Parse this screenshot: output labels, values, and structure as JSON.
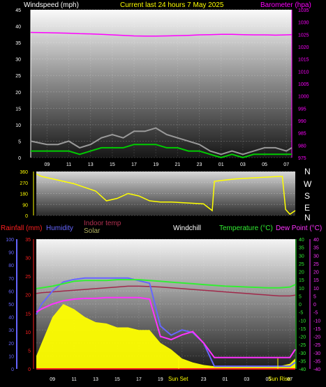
{
  "header": {
    "left_title": "Windspeed (mph)",
    "center_title": "Current last 24 hours 7 May 2025",
    "right_title": "Barometer (hpa)"
  },
  "direction_letters": [
    "N",
    "W",
    "S",
    "E",
    "N"
  ],
  "temp_legend": {
    "rainfall": "Rainfall (mm)",
    "humidity": "Humidity",
    "indoor": "Indoor temp",
    "solar": "Solar",
    "windchill": "Windchill",
    "temperature": "Temperature (°C)",
    "dewpoint": "Dew Point (°C)"
  },
  "sun_labels": {
    "sunset": "Sun Set",
    "sunrise": "Sun Rise"
  },
  "colors": {
    "windspeed": "#ffffff",
    "gust": "#9a9a9a",
    "wind_avg": "#00cc00",
    "barometer": "#ff00ff",
    "direction": "#ffff00",
    "temperature": "#33ee33",
    "dewpoint": "#ff33ff",
    "humidity": "#6666ff",
    "indoor": "#a0284a",
    "solar_fill": "#ffff00",
    "solar_line": "#a0a040",
    "rainfall": "#ff2020",
    "windchill": "#ffffff"
  },
  "chart_data": [
    {
      "type": "line",
      "name": "wind-barometer",
      "x_ticks": [
        "09",
        "11",
        "13",
        "15",
        "17",
        "19",
        "21",
        "23",
        "01",
        "03",
        "05",
        "07"
      ],
      "left_axis": {
        "label": "Windspeed (mph)",
        "range": [
          0,
          45
        ],
        "ticks": [
          0,
          5,
          10,
          15,
          20,
          25,
          30,
          35,
          40,
          45
        ]
      },
      "right_axis": {
        "label": "Barometer (hpa)",
        "range": [
          975,
          1035
        ],
        "ticks": [
          975,
          980,
          985,
          990,
          995,
          1000,
          1005,
          1010,
          1015,
          1020,
          1025,
          1030,
          1035
        ]
      },
      "x_hours": [
        7.5,
        9,
        10,
        11,
        12,
        13,
        14,
        15,
        16,
        17,
        18,
        19,
        20,
        21,
        22,
        23,
        24,
        25,
        26,
        27,
        28,
        29,
        30,
        31,
        31.5
      ],
      "series": [
        {
          "name": "Barometer",
          "axis": "right",
          "values": [
            1025.8,
            1025.7,
            1025.6,
            1025.5,
            1025.3,
            1025.2,
            1025.0,
            1024.8,
            1024.6,
            1024.4,
            1024.3,
            1024.3,
            1024.4,
            1024.5,
            1024.6,
            1024.8,
            1024.9,
            1025.0,
            1025.0,
            1024.9,
            1024.8,
            1024.8,
            1024.7,
            1024.8,
            1024.9
          ]
        },
        {
          "name": "Wind gust",
          "axis": "left",
          "values": [
            5,
            4,
            4,
            5,
            3,
            4,
            6,
            7,
            6,
            8,
            8,
            9,
            7,
            6,
            5,
            4,
            2,
            1,
            2,
            1,
            2,
            3,
            3,
            2,
            3
          ]
        },
        {
          "name": "Wind speed",
          "axis": "left",
          "values": [
            2,
            2,
            2,
            2,
            1,
            2,
            3,
            3,
            3,
            4,
            4,
            4,
            3,
            3,
            2,
            2,
            1,
            0,
            1,
            0,
            1,
            1,
            1,
            1,
            1
          ]
        }
      ]
    },
    {
      "type": "line",
      "name": "wind-direction",
      "left_axis": {
        "range": [
          0,
          360
        ],
        "ticks": [
          0,
          90,
          180,
          270,
          360
        ]
      },
      "x_hours": [
        7.5,
        8,
        9,
        10,
        11,
        12,
        13,
        14,
        15,
        16,
        17,
        18,
        19,
        20,
        21,
        22,
        23,
        23.8,
        24,
        25,
        26,
        27,
        28,
        29,
        30,
        30.3,
        30.6,
        31,
        31.5
      ],
      "values": [
        340,
        320,
        300,
        280,
        260,
        230,
        200,
        120,
        140,
        180,
        160,
        120,
        110,
        110,
        105,
        100,
        95,
        40,
        280,
        290,
        300,
        305,
        310,
        315,
        320,
        320,
        50,
        10,
        40
      ]
    },
    {
      "type": "line",
      "name": "temperature-humidity",
      "left_axis": {
        "label": "Rainfall (mm)",
        "range": [
          0,
          35
        ],
        "ticks": [
          0,
          5,
          10,
          15,
          20,
          25,
          30,
          35
        ]
      },
      "humidity_axis": {
        "label": "Humidity",
        "range": [
          0,
          100
        ],
        "ticks": [
          0,
          10,
          20,
          30,
          40,
          50,
          60,
          70,
          80,
          90,
          100
        ]
      },
      "temp_axis": {
        "label": "Temperature (°C)",
        "range": [
          -40,
          40
        ],
        "ticks": [
          -40,
          -35,
          -30,
          -25,
          -20,
          -15,
          -10,
          -5,
          0,
          5,
          10,
          15,
          20,
          25,
          30,
          35,
          40
        ]
      },
      "dew_axis": {
        "label": "Dew Point (°C)",
        "range": [
          -40,
          40
        ],
        "ticks": [
          -40,
          -35,
          -30,
          -25,
          -20,
          -15,
          -10,
          -5,
          0,
          5,
          10,
          15,
          20,
          25,
          30,
          35,
          40
        ]
      },
      "x_hours": [
        7.5,
        8,
        9,
        10,
        11,
        12,
        13,
        14,
        15,
        16,
        17,
        18,
        19,
        20,
        21,
        22,
        23,
        24,
        25,
        26,
        27,
        28,
        29,
        30,
        31,
        31.5
      ],
      "series": [
        {
          "name": "Temperature",
          "unit": "°C",
          "values": [
            9.5,
            10,
            11,
            12.5,
            14,
            14.5,
            14.5,
            14.5,
            15,
            15,
            15,
            14.5,
            14,
            13.5,
            13,
            12.5,
            12,
            11.5,
            11,
            10.8,
            10.5,
            10.3,
            10,
            10,
            10.5,
            12
          ]
        },
        {
          "name": "Indoor temp",
          "unit": "°C",
          "values": [
            6.5,
            7,
            7.5,
            8,
            8.5,
            9,
            9.5,
            10,
            10.5,
            11,
            11,
            10.8,
            10.5,
            10,
            9.5,
            9,
            8.5,
            8,
            7.5,
            7,
            6.5,
            6,
            5.5,
            5,
            5,
            5.5
          ]
        },
        {
          "name": "Dew Point",
          "unit": "°C",
          "values": [
            -5,
            -3,
            0,
            2,
            3,
            3.5,
            3.5,
            4,
            4,
            4,
            4,
            3,
            -20,
            -22,
            -19,
            -17,
            -24,
            -33,
            -33,
            -33,
            -33,
            -33,
            -33,
            -33,
            -33,
            -28
          ]
        },
        {
          "name": "Humidity",
          "unit": "%",
          "values": [
            42,
            50,
            60,
            67,
            69,
            70,
            70,
            70,
            70,
            70,
            68,
            66,
            33,
            26,
            30,
            28,
            20,
            2,
            2,
            2,
            2,
            2,
            2,
            2,
            2,
            5
          ]
        },
        {
          "name": "Solar",
          "unit": "",
          "values": [
            10,
            20,
            40,
            50,
            46,
            40,
            36,
            35,
            32,
            32,
            30,
            30,
            20,
            15,
            8,
            5,
            3,
            2,
            2,
            2,
            2,
            2,
            2,
            2,
            4,
            8
          ]
        },
        {
          "name": "Rainfall",
          "unit": "mm",
          "values": [
            0,
            0,
            0,
            0,
            0,
            0,
            0,
            0,
            0,
            0,
            0,
            0,
            0,
            0,
            0,
            0,
            0,
            0,
            0,
            0,
            0,
            0,
            0,
            0,
            0,
            0
          ]
        }
      ]
    }
  ]
}
